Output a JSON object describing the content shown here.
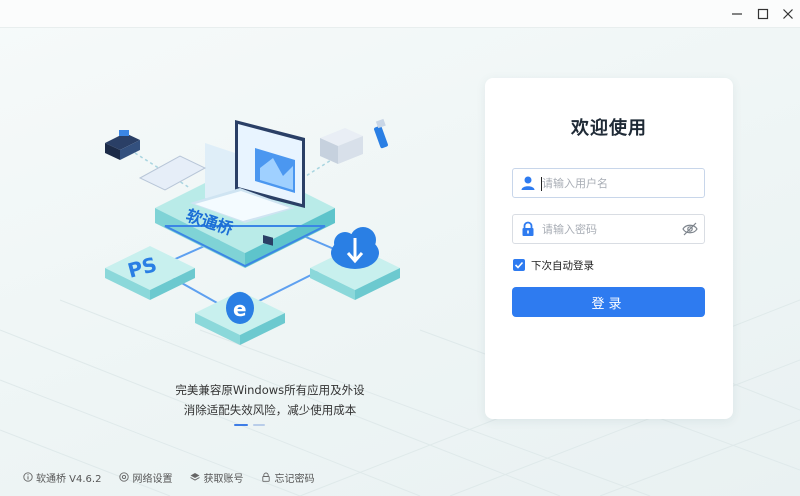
{
  "window": {
    "controls": [
      {
        "name": "minimize",
        "icon": "minimize-icon"
      },
      {
        "name": "maximize",
        "icon": "maximize-icon"
      },
      {
        "name": "close",
        "icon": "close-icon"
      }
    ]
  },
  "illustration": {
    "screen_brand": "软通桥",
    "badges": [
      "PS",
      "e"
    ]
  },
  "slogan": {
    "line1": "完美兼容原Windows所有应用及外设",
    "line2": "消除适配失效风险，减少使用成本"
  },
  "login": {
    "title": "欢迎使用",
    "username": {
      "placeholder": "请输入用户名",
      "value": "",
      "icon": "user-icon"
    },
    "password": {
      "placeholder": "请输入密码",
      "value": "",
      "icon": "lock-icon",
      "toggle_icon": "eye-hidden-icon"
    },
    "remember": {
      "label": "下次自动登录",
      "checked": true
    },
    "submit_label": "登录"
  },
  "footer": {
    "version": "软通桥 V4.6.2",
    "network": "网络设置",
    "get_account": "获取账号",
    "forgot_password": "忘记密码"
  },
  "colors": {
    "accent": "#2e7bf0",
    "title": "#1f2a36",
    "background": "#f4f8f8"
  }
}
